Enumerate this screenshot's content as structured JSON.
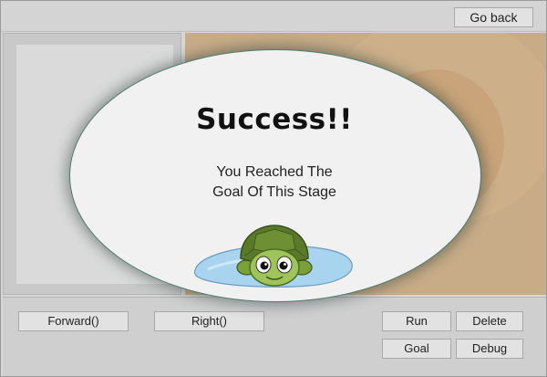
{
  "header": {
    "go_back_label": "Go back"
  },
  "controls": {
    "forward_label": "Forward()",
    "right_label": "Right()",
    "run_label": "Run",
    "delete_label": "Delete",
    "goal_label": "Goal",
    "debug_label": "Debug"
  },
  "dialog": {
    "title": "Success!!",
    "message_line1": "You Reached The",
    "message_line2": "Goal Of This Stage"
  },
  "icons": {
    "character": "turtle-icon",
    "pond": "pond-icon"
  },
  "colors": {
    "stage_background": "#c8ac88",
    "dialog_border": "#4f7a6e",
    "pond_water": "#a9d4f0",
    "turtle_shell": "#5a7a2a",
    "turtle_skin": "#9fc45a"
  }
}
